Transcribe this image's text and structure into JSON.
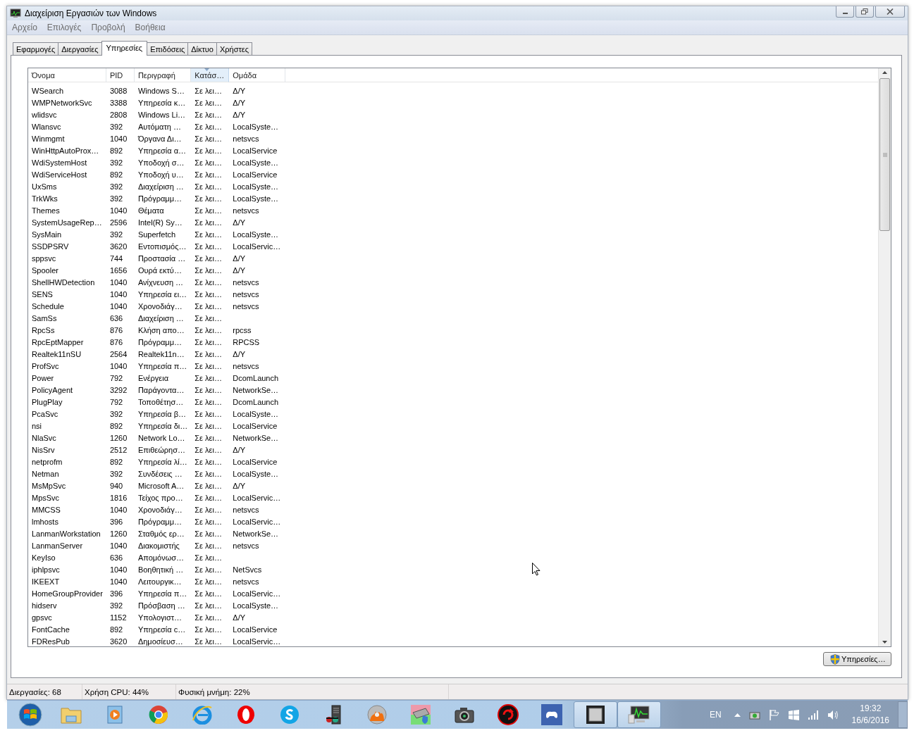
{
  "window": {
    "title": "Διαχείριση Εργασιών των Windows"
  },
  "menu": [
    "Αρχείο",
    "Επιλογές",
    "Προβολή",
    "Βοήθεια"
  ],
  "tabs": [
    {
      "label": "Εφαρμογές",
      "selected": false
    },
    {
      "label": "Διεργασίες",
      "selected": false
    },
    {
      "label": "Υπηρεσίες",
      "selected": true
    },
    {
      "label": "Επιδόσεις",
      "selected": false
    },
    {
      "label": "Δίκτυο",
      "selected": false
    },
    {
      "label": "Χρήστες",
      "selected": false
    }
  ],
  "table": {
    "columns": [
      {
        "label": "Όνομα",
        "sorted": false
      },
      {
        "label": "PID",
        "sorted": false
      },
      {
        "label": "Περιγραφή",
        "sorted": false
      },
      {
        "label": "Κατάσ…",
        "sorted": true
      },
      {
        "label": "Ομάδα",
        "sorted": false
      }
    ],
    "rows": [
      [
        "WSearch",
        "3088",
        "Windows S…",
        "Σε λει…",
        "Δ/Υ"
      ],
      [
        "WMPNetworkSvc",
        "3388",
        "Υπηρεσία κ…",
        "Σε λει…",
        "Δ/Υ"
      ],
      [
        "wlidsvc",
        "2808",
        "Windows Li…",
        "Σε λει…",
        "Δ/Υ"
      ],
      [
        "Wlansvc",
        "392",
        "Αυτόματη …",
        "Σε λει…",
        "LocalSyste…"
      ],
      [
        "Winmgmt",
        "1040",
        "Όργανα Δι…",
        "Σε λει…",
        "netsvcs"
      ],
      [
        "WinHttpAutoProx…",
        "892",
        "Υπηρεσία α…",
        "Σε λει…",
        "LocalService"
      ],
      [
        "WdiSystemHost",
        "392",
        "Υποδοχή σ…",
        "Σε λει…",
        "LocalSyste…"
      ],
      [
        "WdiServiceHost",
        "892",
        "Υποδοχή υ…",
        "Σε λει…",
        "LocalService"
      ],
      [
        "UxSms",
        "392",
        "Διαχείριση …",
        "Σε λει…",
        "LocalSyste…"
      ],
      [
        "TrkWks",
        "392",
        "Πρόγραμμ…",
        "Σε λει…",
        "LocalSyste…"
      ],
      [
        "Themes",
        "1040",
        "Θέματα",
        "Σε λει…",
        "netsvcs"
      ],
      [
        "SystemUsageRep…",
        "2596",
        "Intel(R) Sy…",
        "Σε λει…",
        "Δ/Υ"
      ],
      [
        "SysMain",
        "392",
        "Superfetch",
        "Σε λει…",
        "LocalSyste…"
      ],
      [
        "SSDPSRV",
        "3620",
        "Εντοπισμός…",
        "Σε λει…",
        "LocalServic…"
      ],
      [
        "sppsvc",
        "744",
        "Προστασία …",
        "Σε λει…",
        "Δ/Υ"
      ],
      [
        "Spooler",
        "1656",
        "Ουρά εκτύ…",
        "Σε λει…",
        "Δ/Υ"
      ],
      [
        "ShellHWDetection",
        "1040",
        "Ανίχνευση …",
        "Σε λει…",
        "netsvcs"
      ],
      [
        "SENS",
        "1040",
        "Υπηρεσία ει…",
        "Σε λει…",
        "netsvcs"
      ],
      [
        "Schedule",
        "1040",
        "Χρονοδιάγ…",
        "Σε λει…",
        "netsvcs"
      ],
      [
        "SamSs",
        "636",
        "Διαχείριση …",
        "Σε λει…"
      ],
      [
        "RpcSs",
        "876",
        "Κλήση απο…",
        "Σε λει…",
        "rpcss"
      ],
      [
        "RpcEptMapper",
        "876",
        "Πρόγραμμ…",
        "Σε λει…",
        "RPCSS"
      ],
      [
        "Realtek11nSU",
        "2564",
        "Realtek11n…",
        "Σε λει…",
        "Δ/Υ"
      ],
      [
        "ProfSvc",
        "1040",
        "Υπηρεσία π…",
        "Σε λει…",
        "netsvcs"
      ],
      [
        "Power",
        "792",
        "Ενέργεια",
        "Σε λει…",
        "DcomLaunch"
      ],
      [
        "PolicyAgent",
        "3292",
        "Παράγοντα…",
        "Σε λει…",
        "NetworkSe…"
      ],
      [
        "PlugPlay",
        "792",
        "Τοποθέτησ…",
        "Σε λει…",
        "DcomLaunch"
      ],
      [
        "PcaSvc",
        "392",
        "Υπηρεσία β…",
        "Σε λει…",
        "LocalSyste…"
      ],
      [
        "nsi",
        "892",
        "Υπηρεσία δι…",
        "Σε λει…",
        "LocalService"
      ],
      [
        "NlaSvc",
        "1260",
        "Network Lo…",
        "Σε λει…",
        "NetworkSe…"
      ],
      [
        "NisSrv",
        "2512",
        "Επιθεώρησ…",
        "Σε λει…",
        "Δ/Υ"
      ],
      [
        "netprofm",
        "892",
        "Υπηρεσία λί…",
        "Σε λει…",
        "LocalService"
      ],
      [
        "Netman",
        "392",
        "Συνδέσεις …",
        "Σε λει…",
        "LocalSyste…"
      ],
      [
        "MsMpSvc",
        "940",
        "Microsoft A…",
        "Σε λει…",
        "Δ/Υ"
      ],
      [
        "MpsSvc",
        "1816",
        "Τείχος προ…",
        "Σε λει…",
        "LocalServic…"
      ],
      [
        "MMCSS",
        "1040",
        "Χρονοδιάγ…",
        "Σε λει…",
        "netsvcs"
      ],
      [
        "lmhosts",
        "396",
        "Πρόγραμμ…",
        "Σε λει…",
        "LocalServic…"
      ],
      [
        "LanmanWorkstation",
        "1260",
        "Σταθμός ερ…",
        "Σε λει…",
        "NetworkSe…"
      ],
      [
        "LanmanServer",
        "1040",
        "Διακομιστής",
        "Σε λει…",
        "netsvcs"
      ],
      [
        "KeyIso",
        "636",
        "Απομόνωσ…",
        "Σε λει…"
      ],
      [
        "iphlpsvc",
        "1040",
        "Βοηθητική …",
        "Σε λει…",
        "NetSvcs"
      ],
      [
        "IKEEXT",
        "1040",
        "Λειτουργικ…",
        "Σε λει…",
        "netsvcs"
      ],
      [
        "HomeGroupProvider",
        "396",
        "Υπηρεσία π…",
        "Σε λει…",
        "LocalServic…"
      ],
      [
        "hidserv",
        "392",
        "Πρόσβαση …",
        "Σε λει…",
        "LocalSyste…"
      ],
      [
        "gpsvc",
        "1152",
        "Υπολογιστ…",
        "Σε λει…",
        "Δ/Υ"
      ],
      [
        "FontCache",
        "892",
        "Υπηρεσία c…",
        "Σε λει…",
        "LocalService"
      ],
      [
        "FDResPub",
        "3620",
        "Δημοσίευσ…",
        "Σε λει…",
        "LocalServic…"
      ]
    ]
  },
  "services_button": "Υπηρεσίες…",
  "status_bar": [
    "Διεργασίες: 68",
    "Χρήση CPU: 44%",
    "Φυσική μνήμη: 22%"
  ],
  "taskbar": {
    "apps": [
      {
        "kind": "folder",
        "running": false
      },
      {
        "kind": "player",
        "running": false
      },
      {
        "kind": "chrome",
        "running": false
      },
      {
        "kind": "ie",
        "running": false
      },
      {
        "kind": "opera",
        "running": false
      },
      {
        "kind": "skype",
        "running": false
      },
      {
        "kind": "tower",
        "running": false
      },
      {
        "kind": "disc",
        "running": false
      },
      {
        "kind": "drive",
        "running": false
      },
      {
        "kind": "camera",
        "running": false
      },
      {
        "kind": "redcircle",
        "running": false
      },
      {
        "kind": "gamepad",
        "running": false
      },
      {
        "kind": "chip",
        "running": true
      },
      {
        "kind": "monitor",
        "running": true
      }
    ],
    "language": "EN",
    "time": "19:32",
    "date": "16/6/2016"
  }
}
